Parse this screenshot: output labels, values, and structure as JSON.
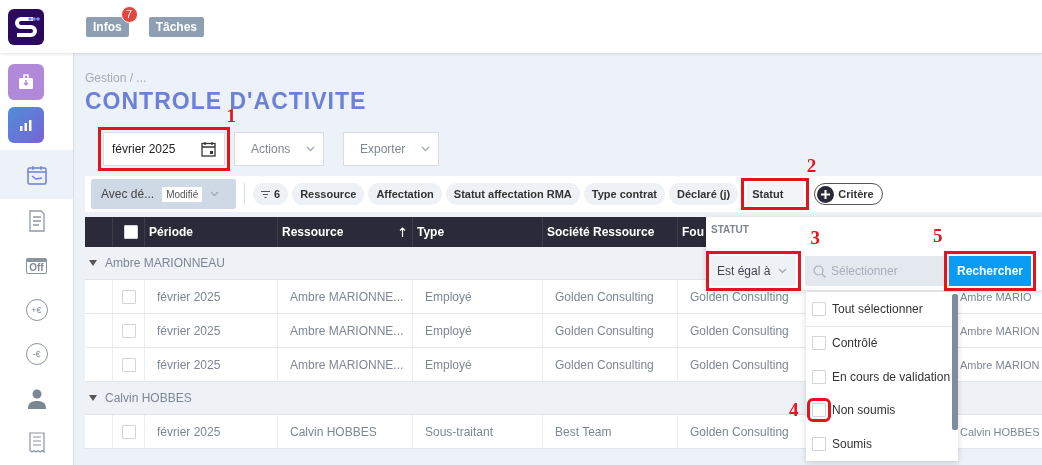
{
  "header": {
    "tabs": [
      {
        "label": "Infos",
        "badge": "7"
      },
      {
        "label": "Tâches"
      }
    ]
  },
  "sidebar": {
    "items": [
      {
        "kind": "export",
        "selected": false
      },
      {
        "kind": "chart",
        "selected": false
      },
      {
        "kind": "calendar",
        "selected": true
      },
      {
        "kind": "document",
        "selected": false
      },
      {
        "kind": "off",
        "label": "Off",
        "selected": false
      },
      {
        "kind": "coin",
        "label": "+€",
        "selected": false
      },
      {
        "kind": "coin",
        "label": "-€",
        "selected": false
      },
      {
        "kind": "person",
        "selected": false
      },
      {
        "kind": "receipt",
        "selected": false
      }
    ]
  },
  "breadcrumb": "Gestion / ...",
  "title": "CONTROLE D'ACTIVITE",
  "toolbar": {
    "period": {
      "value": "février 2025",
      "annotation": "1"
    },
    "buttons": [
      "Actions",
      "Exporter"
    ]
  },
  "filters": {
    "view": {
      "value": "Avec dé...",
      "tag": "Modifié"
    },
    "chips": [
      {
        "kind": "count",
        "label": "6"
      },
      {
        "kind": "field",
        "label": "Ressource"
      },
      {
        "kind": "field",
        "label": "Affectation"
      },
      {
        "kind": "field",
        "label": "Statut affectation RMA"
      },
      {
        "kind": "field",
        "label": "Type contrat"
      },
      {
        "kind": "field",
        "label": "Déclaré (j)"
      },
      {
        "kind": "field",
        "label": "Statut",
        "annotation": "2"
      },
      {
        "kind": "add",
        "label": "Critère"
      }
    ]
  },
  "table": {
    "header_checked": false,
    "columns": [
      {
        "label": "Période",
        "sorted": false
      },
      {
        "label": "Ressource",
        "sorted": true
      },
      {
        "label": "Type",
        "sorted": false
      },
      {
        "label": "Société Ressource",
        "sorted": false
      },
      {
        "label": "Fou"
      }
    ],
    "groups": [
      {
        "label": "Ambre MARIONNEAU",
        "expanded": true,
        "rows": [
          {
            "checked": false,
            "cells": [
              "février 2025",
              "Ambre MARIONNE...",
              "Employé",
              "Golden Consulting",
              "Golden Consulting",
              "Ambre MARIO"
            ]
          },
          {
            "checked": false,
            "cells": [
              "février 2025",
              "Ambre MARIONNE...",
              "Employé",
              "Golden Consulting",
              "Golden Consulting",
              "Ambre MARION"
            ]
          },
          {
            "checked": false,
            "cells": [
              "février 2025",
              "Ambre MARIONNE...",
              "Employé",
              "Golden Consulting",
              "Golden Consulting",
              "Ambre MARION"
            ]
          }
        ]
      },
      {
        "label": "Calvin HOBBES",
        "expanded": true,
        "rows": [
          {
            "checked": false,
            "cells": [
              "février 2025",
              "Calvin HOBBES",
              "Sous-traitant",
              "Best Team",
              "Golden Consulting",
              "Calvin HOBBES"
            ]
          }
        ]
      }
    ]
  },
  "popup": {
    "title": "STATUT",
    "operator": {
      "value": "Est égal à",
      "annotation": "3"
    },
    "search": {
      "placeholder": "Sélectionner"
    },
    "button": {
      "label": "Rechercher",
      "annotation": "5"
    },
    "options": [
      {
        "label": "Tout sélectionner",
        "checked": false
      },
      {
        "label": "Contrôlé",
        "checked": false
      },
      {
        "label": "En cours de validation",
        "checked": false
      },
      {
        "label": "Non soumis",
        "checked": false,
        "annotation": "4"
      },
      {
        "label": "Soumis",
        "checked": false
      }
    ]
  }
}
